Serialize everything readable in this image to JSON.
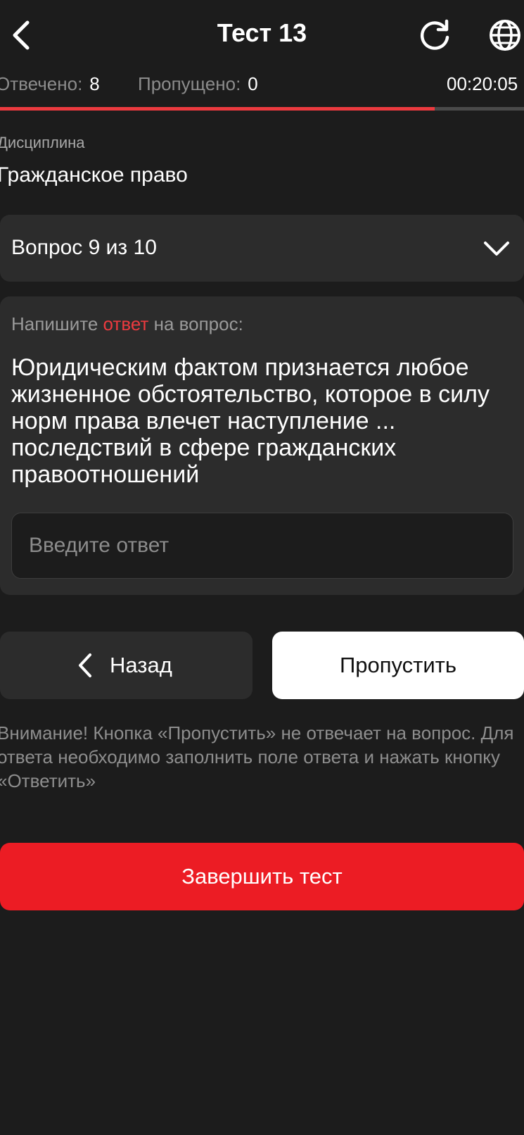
{
  "header": {
    "title": "Тест 13",
    "back_icon": "chevron-left-icon",
    "refresh_icon": "refresh-icon",
    "language_icon": "globe-icon"
  },
  "stats": {
    "answered_label": "Отвечено:",
    "answered_value": "8",
    "skipped_label": "Пропущено:",
    "skipped_value": "0",
    "timer": "00:20:05"
  },
  "progress": {
    "fraction": 0.83
  },
  "discipline": {
    "label": "Дисциплина",
    "value": "Гражданское право"
  },
  "question_selector": {
    "label": "Вопрос 9 из 10",
    "icon": "chevron-down-icon"
  },
  "question": {
    "prompt_prefix": "Напишите ",
    "prompt_accent": "ответ",
    "prompt_suffix": " на вопрос:",
    "text": "Юридическим фактом признается любое жизненное обстоятельство, которое в силу норм права влечет наступление ... последствий в сфере гражданских правоотношений",
    "input_placeholder": "Введите ответ",
    "input_value": ""
  },
  "nav": {
    "back_label": "Назад",
    "skip_label": "Пропустить"
  },
  "warning": {
    "text": "Внимание! Кнопка «Пропустить» не отвечает на вопрос. Для ответа необходимо заполнить поле ответа и нажать кнопку «Ответить»"
  },
  "finish": {
    "label": "Завершить тест"
  },
  "colors": {
    "background": "#1c1c1c",
    "card": "#2c2c2c",
    "accent_red": "#ec1c24",
    "progress_red": "#ec3a3f"
  }
}
